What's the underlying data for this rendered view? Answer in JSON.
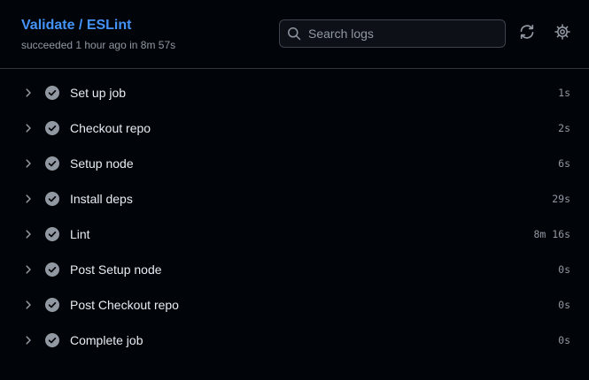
{
  "header": {
    "title": "Validate / ESLint",
    "subtitle": "succeeded 1 hour ago in 8m 57s"
  },
  "search": {
    "placeholder": "Search logs",
    "value": "",
    "icon": "search-icon"
  },
  "toolbar": {
    "refresh_icon": "refresh-icon",
    "settings_icon": "gear-icon"
  },
  "colors": {
    "background": "#010409",
    "title_link": "#4493f8",
    "muted_text": "#9198a1",
    "primary_text": "#e6edf3",
    "success_check": "#9198a1",
    "border": "#30363d"
  },
  "steps": [
    {
      "label": "Set up job",
      "duration": "1s",
      "status": "success"
    },
    {
      "label": "Checkout repo",
      "duration": "2s",
      "status": "success"
    },
    {
      "label": "Setup node",
      "duration": "6s",
      "status": "success"
    },
    {
      "label": "Install deps",
      "duration": "29s",
      "status": "success"
    },
    {
      "label": "Lint",
      "duration": "8m 16s",
      "status": "success"
    },
    {
      "label": "Post Setup node",
      "duration": "0s",
      "status": "success"
    },
    {
      "label": "Post Checkout repo",
      "duration": "0s",
      "status": "success"
    },
    {
      "label": "Complete job",
      "duration": "0s",
      "status": "success"
    }
  ]
}
